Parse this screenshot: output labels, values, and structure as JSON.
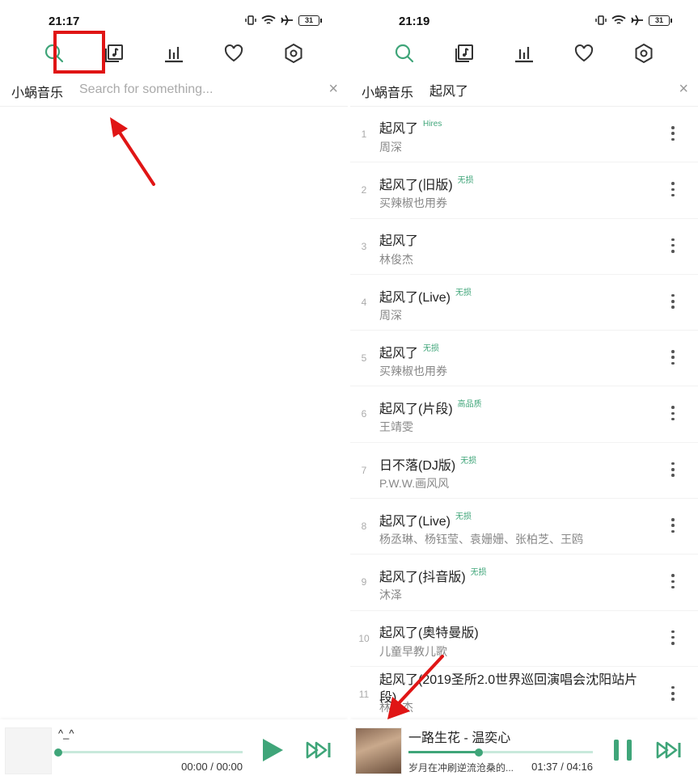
{
  "left": {
    "status": {
      "time": "21:17",
      "battery": "31"
    },
    "header": {
      "app_name": "小蜗音乐",
      "search_placeholder": "Search for something...",
      "search_value": "",
      "clear": "×"
    },
    "player": {
      "title": "^_^",
      "time": "00:00 / 00:00",
      "progress": 0
    }
  },
  "right": {
    "status": {
      "time": "21:19",
      "battery": "31"
    },
    "header": {
      "app_name": "小蜗音乐",
      "search_value": "起风了",
      "clear": "×"
    },
    "songs": [
      {
        "index": "1",
        "title": "起风了",
        "tag": "Hires",
        "artist": "周深"
      },
      {
        "index": "2",
        "title": "起风了(旧版)",
        "tag": "无损",
        "artist": "买辣椒也用券"
      },
      {
        "index": "3",
        "title": "起风了",
        "tag": "",
        "artist": "林俊杰"
      },
      {
        "index": "4",
        "title": "起风了(Live)",
        "tag": "无损",
        "artist": "周深"
      },
      {
        "index": "5",
        "title": "起风了",
        "tag": "无损",
        "artist": "买辣椒也用券"
      },
      {
        "index": "6",
        "title": "起风了(片段)",
        "tag": "高品质",
        "artist": "王靖雯"
      },
      {
        "index": "7",
        "title": "日不落(DJ版)",
        "tag": "无损",
        "artist": "P.W.W.画风风"
      },
      {
        "index": "8",
        "title": "起风了(Live)",
        "tag": "无损",
        "artist": "杨丞琳、杨钰莹、袁姗姗、张柏芝、王鸥"
      },
      {
        "index": "9",
        "title": "起风了(抖音版)",
        "tag": "无损",
        "artist": "沐泽"
      },
      {
        "index": "10",
        "title": "起风了(奥特曼版)",
        "tag": "",
        "artist": "儿童早教儿歌"
      },
      {
        "index": "11",
        "title": "起风了(2019圣所2.0世界巡回演唱会沈阳站片段)",
        "tag": "",
        "artist": "林俊杰"
      }
    ],
    "player": {
      "title": "一路生花 - 温奕心",
      "subtitle": "岁月在冲刷逆流沧桑的...",
      "time": "01:37 / 04:16",
      "progress": 0.38
    }
  },
  "colors": {
    "accent": "#3fa579",
    "annotation": "#e01515"
  },
  "icons": [
    "search-icon",
    "music-library-icon",
    "bar-chart-icon",
    "heart-icon",
    "settings-hexagon-icon",
    "play-icon",
    "pause-icon",
    "skip-next-icon"
  ]
}
